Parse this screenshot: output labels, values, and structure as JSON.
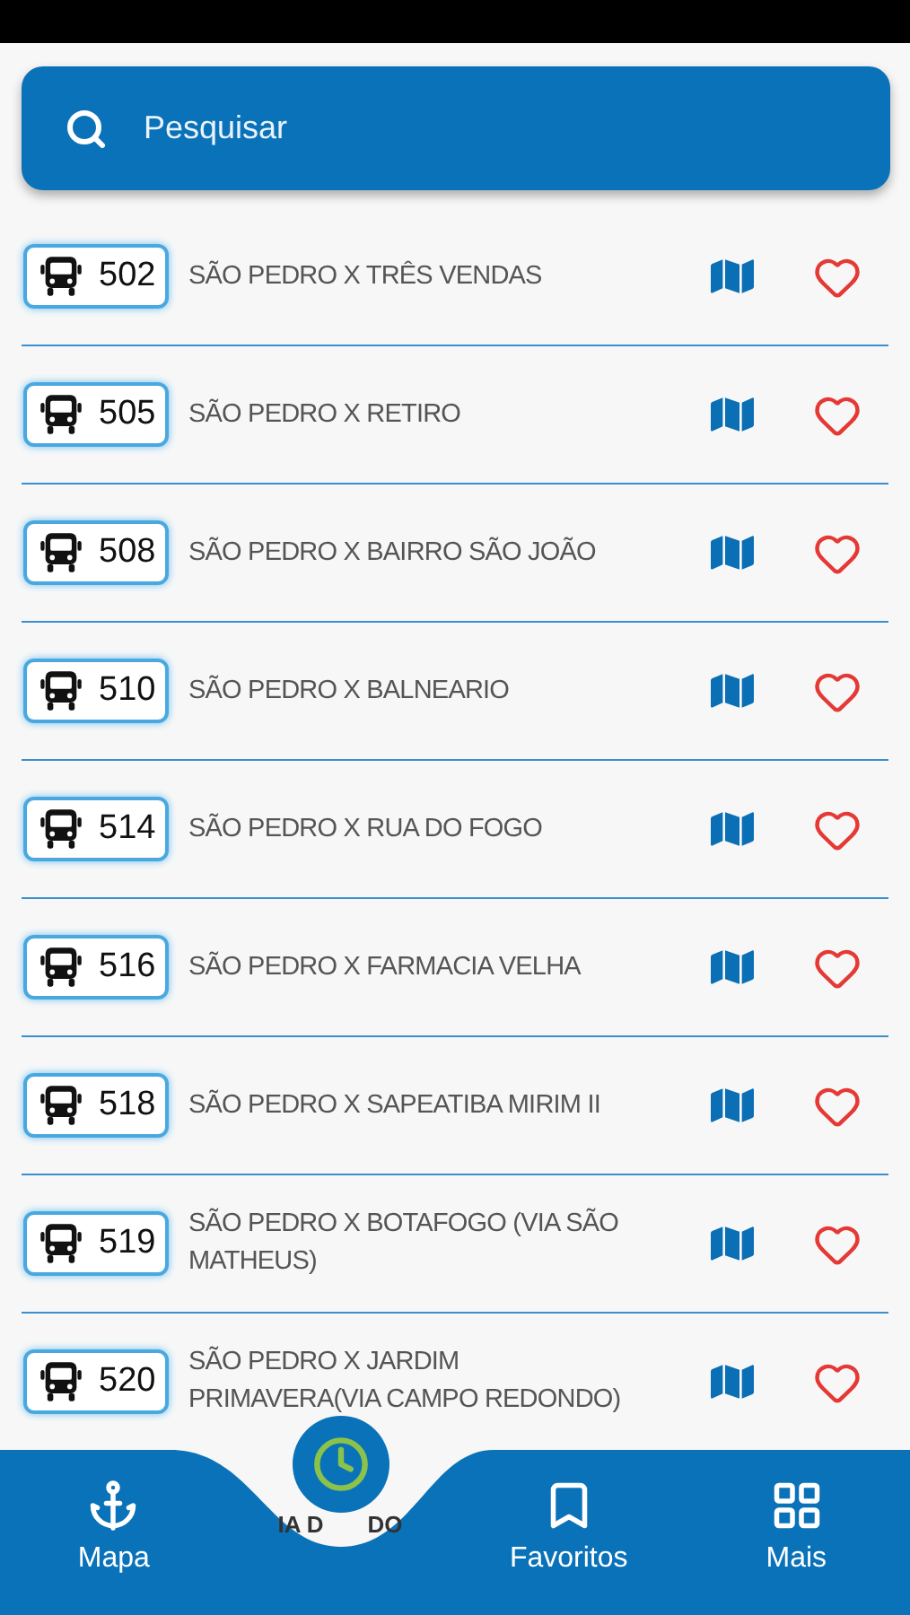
{
  "search": {
    "placeholder": "Pesquisar"
  },
  "routes": [
    {
      "number": "502",
      "name": "SÃO PEDRO X TRÊS VENDAS",
      "favorite": false
    },
    {
      "number": "505",
      "name": "SÃO PEDRO X RETIRO",
      "favorite": false
    },
    {
      "number": "508",
      "name": "SÃO PEDRO X BAIRRO SÃO JOÃO",
      "favorite": false
    },
    {
      "number": "510",
      "name": "SÃO PEDRO X BALNEARIO",
      "favorite": false
    },
    {
      "number": "514",
      "name": "SÃO PEDRO X RUA DO FOGO",
      "favorite": false
    },
    {
      "number": "516",
      "name": "SÃO PEDRO X FARMACIA VELHA",
      "favorite": false
    },
    {
      "number": "518",
      "name": "SÃO PEDRO X SAPEATIBA MIRIM II",
      "favorite": false
    },
    {
      "number": "519",
      "name": "SÃO PEDRO X BOTAFOGO (VIA SÃO MATHEUS)",
      "favorite": false
    },
    {
      "number": "520",
      "name": "SÃO PEDRO X JARDIM PRIMAVERA(VIA CAMPO REDONDO)",
      "favorite": false
    }
  ],
  "nav": [
    {
      "kind": "map",
      "label": "Mapa"
    },
    {
      "kind": "center",
      "label_parts": [
        "IA D",
        "DO"
      ]
    },
    {
      "kind": "favorites",
      "label": "Favoritos"
    },
    {
      "kind": "more",
      "label": "Mais"
    }
  ]
}
